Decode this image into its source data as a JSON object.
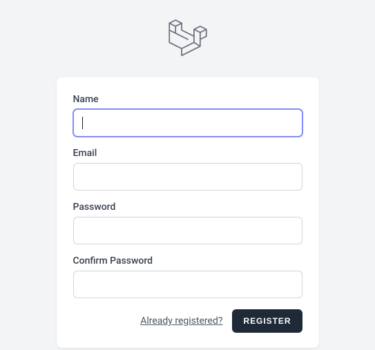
{
  "logo": {
    "name": "laravel-logo"
  },
  "form": {
    "name": {
      "label": "Name",
      "value": ""
    },
    "email": {
      "label": "Email",
      "value": ""
    },
    "password": {
      "label": "Password",
      "value": ""
    },
    "confirm_password": {
      "label": "Confirm Password",
      "value": ""
    }
  },
  "actions": {
    "already_registered": "Already registered?",
    "register": "Register"
  }
}
